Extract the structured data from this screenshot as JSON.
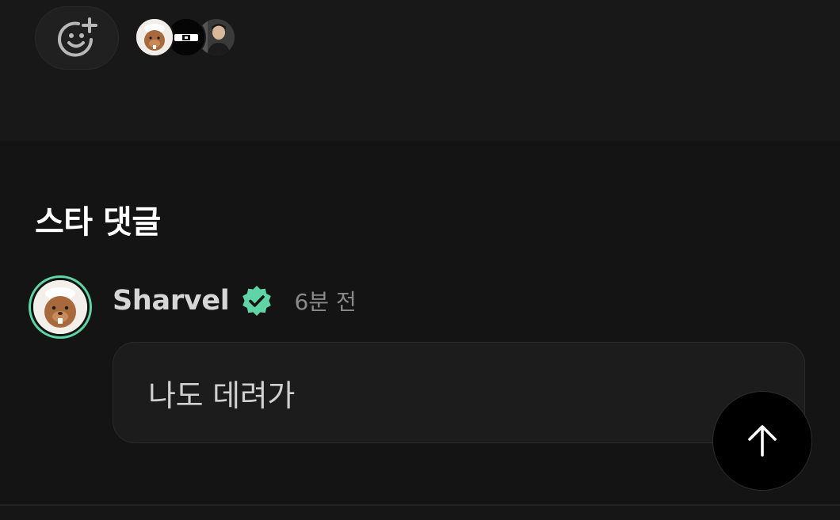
{
  "reactions": {
    "add_icon": "add-reaction-smiley-icon",
    "avatars": [
      {
        "icon": "beaver-avatar-icon"
      },
      {
        "icon": "mask-avatar-icon"
      },
      {
        "icon": "person-avatar-icon"
      }
    ]
  },
  "star_comments": {
    "title": "스타 댓글",
    "comment": {
      "author": "Sharvel",
      "verified_icon": "verified-badge-icon",
      "time": "6분 전",
      "text": "나도 데려가"
    }
  },
  "scroll_top": {
    "icon": "arrow-up-icon"
  },
  "colors": {
    "background": "#141414",
    "accent": "#5fd4a6",
    "bubble": "#1c1c1c"
  }
}
